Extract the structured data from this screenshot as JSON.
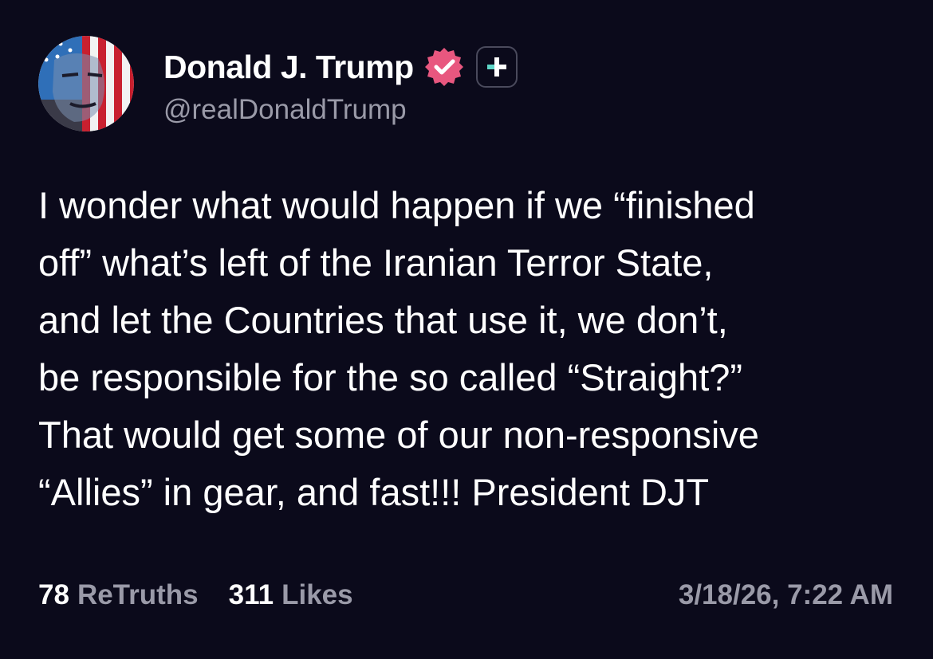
{
  "author": {
    "display_name": "Donald J. Trump",
    "handle": "@realDonaldTrump",
    "verified_icon": "verified-badge-icon",
    "plus_icon": "plus-badge-icon",
    "avatar_icon": "profile-avatar"
  },
  "post": {
    "text": "I wonder what would happen if we “finished\noff” what’s left of the Iranian Terror State,\nand let the Countries that use it, we don’t,\nbe responsible for the so called “Straight?”\nThat would get some of our non-responsive\n“Allies” in gear, and fast!!! President DJT"
  },
  "stats": {
    "retruths_count": "78",
    "retruths_label": "ReTruths",
    "likes_count": "311",
    "likes_label": "Likes"
  },
  "timestamp": "3/18/26, 7:22 AM",
  "colors": {
    "background": "#0b0a1b",
    "text_primary": "#ffffff",
    "text_secondary": "#9a9aa8",
    "verified_pink": "#e8577f",
    "plus_accent": "#5fd6c8"
  }
}
